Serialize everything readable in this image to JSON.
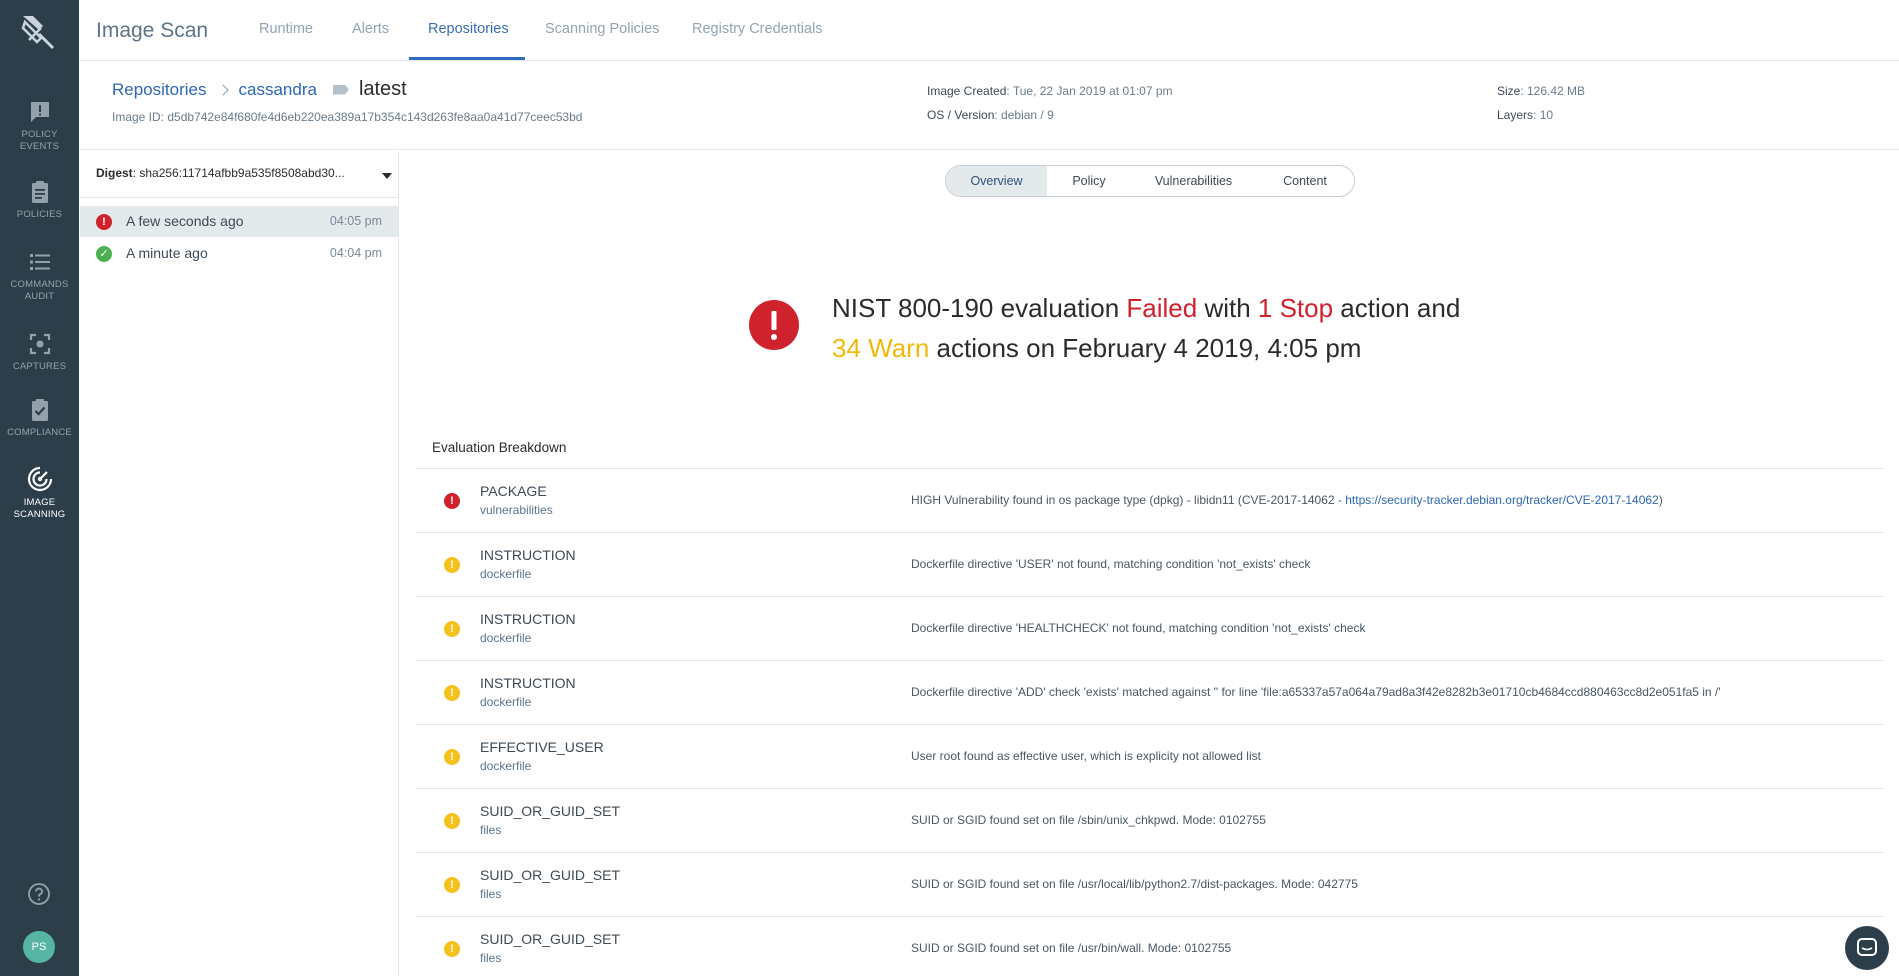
{
  "nav": {
    "app_title": "Image Scan",
    "tabs": [
      {
        "label": "Runtime"
      },
      {
        "label": "Alerts"
      },
      {
        "label": "Repositories"
      },
      {
        "label": "Scanning Policies"
      },
      {
        "label": "Registry Credentials"
      }
    ],
    "active_tab": "Repositories"
  },
  "rail": {
    "items": [
      {
        "label1": "POLICY",
        "label2": "EVENTS",
        "icon": "alert-bubble-icon"
      },
      {
        "label1": "POLICIES",
        "label2": "",
        "icon": "clipboard-icon"
      },
      {
        "label1": "COMMANDS",
        "label2": "AUDIT",
        "icon": "list-icon"
      },
      {
        "label1": "CAPTURES",
        "label2": "",
        "icon": "capture-icon"
      },
      {
        "label1": "COMPLIANCE",
        "label2": "",
        "icon": "compliance-check-icon"
      },
      {
        "label1": "IMAGE",
        "label2": "SCANNING",
        "icon": "image-scanning-icon",
        "active": true
      }
    ],
    "avatar": "PS"
  },
  "header": {
    "breadcrumb": {
      "root": "Repositories",
      "repo": "cassandra",
      "tag": "latest"
    },
    "image_id_label": "Image ID: ",
    "image_id": "d5db742e84f680fe4d6eb220ea389a17b354c143d263fe8aa0a41d77ceec53bd",
    "image_created_label": "Image Created",
    "image_created": ": Tue, 22 Jan 2019 at 01:07 pm",
    "os_label": "OS / Version",
    "os": ": debian / 9",
    "size_label": "Size",
    "size": ": 126.42 MB",
    "layers_label": "Layers",
    "layers": ": 10"
  },
  "left_panel": {
    "digest_label": "Digest",
    "digest": ": sha256:11714afbb9a535f8508abd30...",
    "scans": [
      {
        "label": "A few seconds ago",
        "time": "04:05 pm",
        "status": "stop"
      },
      {
        "label": "A minute ago",
        "time": "04:04 pm",
        "status": "ok"
      }
    ]
  },
  "segments": [
    "Overview",
    "Policy",
    "Vulnerabilities",
    "Content"
  ],
  "verdict": {
    "p1": "NIST 800-190 evaluation ",
    "failed": "Failed",
    "p2": " with ",
    "stop": "1 Stop",
    "p3": " action and",
    "warn": "34 Warn",
    "p4": " actions on February 4 2019, 4:05 pm"
  },
  "breakdown": {
    "title": "Evaluation Breakdown",
    "rows": [
      {
        "gate": "PACKAGE",
        "trigger": "vulnerabilities",
        "level": "stop",
        "msg": "HIGH Vulnerability found in os package type (dpkg) - libidn11 (CVE-2017-14062 - ",
        "link": "https://security-tracker.debian.org/tracker/CVE-2017-14062",
        "msg_end": ")"
      },
      {
        "gate": "INSTRUCTION",
        "trigger": "dockerfile",
        "level": "warn",
        "msg": "Dockerfile directive 'USER' not found, matching condition 'not_exists' check"
      },
      {
        "gate": "INSTRUCTION",
        "trigger": "dockerfile",
        "level": "warn",
        "msg": "Dockerfile directive 'HEALTHCHECK' not found, matching condition 'not_exists' check"
      },
      {
        "gate": "INSTRUCTION",
        "trigger": "dockerfile",
        "level": "warn",
        "msg": "Dockerfile directive 'ADD' check 'exists' matched against '' for line 'file:a65337a57a064a79ad8a3f42e8282b3e01710cb4684ccd880463cc8d2e051fa5 in /'"
      },
      {
        "gate": "EFFECTIVE_USER",
        "trigger": "dockerfile",
        "level": "warn",
        "msg": "User root found as effective user, which is explicity not allowed list"
      },
      {
        "gate": "SUID_OR_GUID_SET",
        "trigger": "files",
        "level": "warn",
        "msg": "SUID or SGID found set on file /sbin/unix_chkpwd. Mode: 0102755"
      },
      {
        "gate": "SUID_OR_GUID_SET",
        "trigger": "files",
        "level": "warn",
        "msg": "SUID or SGID found set on file /usr/local/lib/python2.7/dist-packages. Mode: 042775"
      },
      {
        "gate": "SUID_OR_GUID_SET",
        "trigger": "files",
        "level": "warn",
        "msg": "SUID or SGID found set on file /usr/bin/wall. Mode: 0102755"
      }
    ]
  },
  "colors": {
    "rail": "#2d3e4b",
    "accent": "#2e6bc4",
    "stop": "#d0222d",
    "warn": "#f5c21b",
    "ok": "#4caf50"
  }
}
